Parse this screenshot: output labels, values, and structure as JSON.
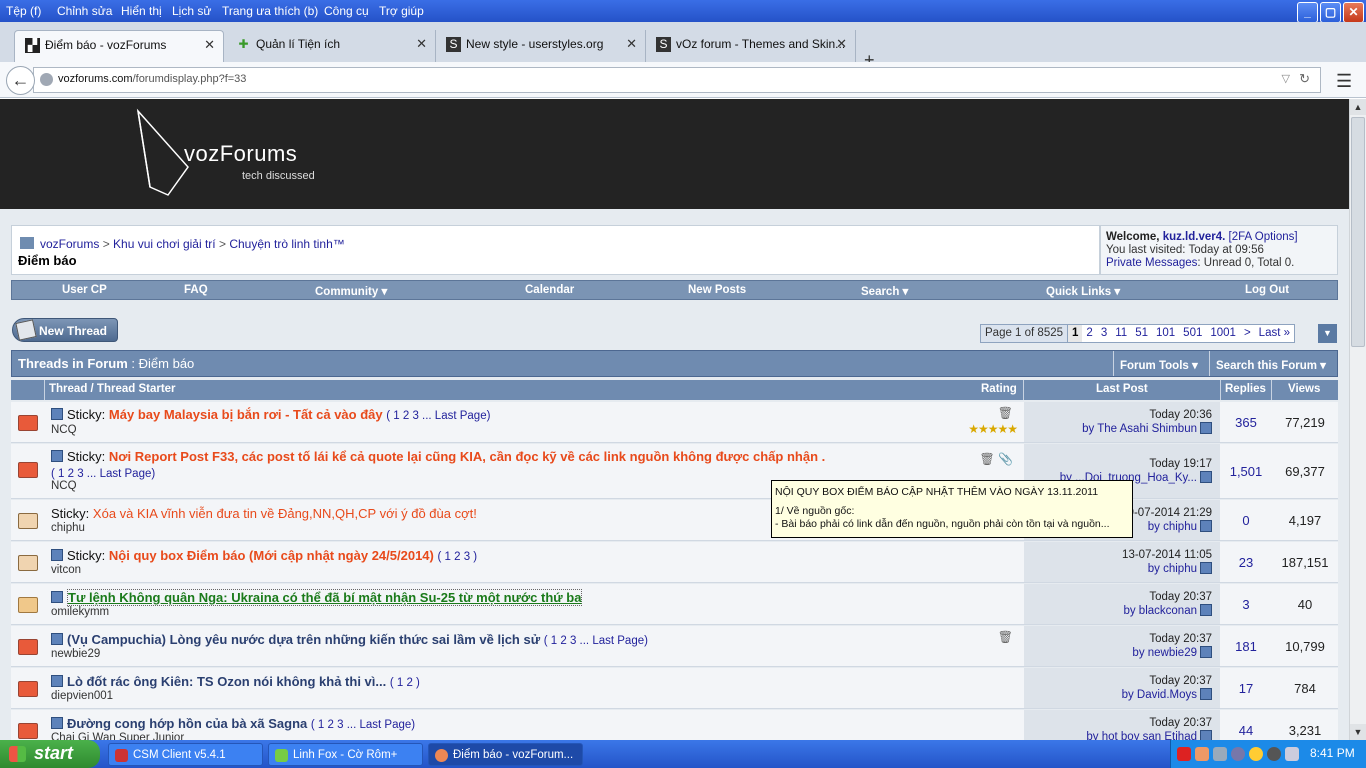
{
  "menu": [
    "Tệp (f)",
    "Chỉnh sửa",
    "Hiển thị",
    "Lịch sử",
    "Trang ưa thích (b)",
    "Công cụ",
    "Trợ giúp"
  ],
  "window_buttons": {
    "minimize": "_",
    "maximize": "▢",
    "close": "✕"
  },
  "tabs": [
    {
      "label": "Điểm báo - vozForums",
      "icon": "voz-icon",
      "active": true
    },
    {
      "label": "Quản lí Tiện ích",
      "icon": "puzzle-icon",
      "active": false
    },
    {
      "label": "New style - userstyles.org",
      "icon": "s-icon",
      "active": false
    },
    {
      "label": "vOz forum - Themes and Skin...",
      "icon": "s-icon",
      "active": false
    }
  ],
  "tab_close": "✕",
  "new_tab": "+",
  "url": {
    "host": "vozforums.com",
    "path": "/forumdisplay.php?f=33"
  },
  "logo": {
    "text": "vozForums",
    "tagline": "tech discussed"
  },
  "breadcrumbs": [
    "vozForums",
    "Khu vui chơi giải trí",
    "Chuyện trò linh tinh™"
  ],
  "crumb_sep": ">",
  "forum_title": "Điểm báo",
  "welcome": {
    "welcome_label": "Welcome,",
    "user": "kuz.ld.ver4.",
    "twofa": "[2FA Options]",
    "last_visited": "You last visited: Today at 09:56",
    "pm_label": "Private Messages",
    "pm_status": ": Unread 0, Total 0."
  },
  "navstrip": [
    "User CP",
    "FAQ",
    "Community ▾",
    "Calendar",
    "New Posts",
    "Search ▾",
    "Quick Links ▾",
    "Log Out"
  ],
  "new_thread": "New Thread",
  "pager": {
    "label": "Page 1 of 8525",
    "pages": [
      "1",
      "2",
      "3",
      "11",
      "51",
      "101",
      "501",
      "1001",
      ">",
      "Last »"
    ],
    "dropdown": "▼"
  },
  "threads_header": {
    "title": "Threads in Forum",
    "forum": ": Điểm báo",
    "tools": "Forum Tools ▾",
    "search": "Search this Forum ▾"
  },
  "columns": {
    "thread": "Thread / Thread Starter",
    "rating": "Rating",
    "last_post": "Last Post",
    "replies": "Replies",
    "views": "Views"
  },
  "threads": [
    {
      "prefix": "Sticky:",
      "title": "Máy bay Malaysia bị bắn rơi - Tất cả vào đây",
      "pages": "( 1 2 3 ... Last Page)",
      "starter": "NCQ",
      "rating": "★★★★★",
      "icons": "🗑",
      "date": "Today 20:36",
      "by": "by The Asahi Shimbun",
      "replies": "365",
      "views": "77,219"
    },
    {
      "prefix": "Sticky:",
      "title": "Nơi Report Post F33, các post tố lái kể cả quote lại cũng KIA, cần đọc kỹ về các link nguồn không được chấp nhận .",
      "pages": "( 1 2 3 ... Last Page)",
      "starter": "NCQ",
      "rating": "★★★★",
      "icons": "🗑 📎",
      "date": "Today 19:17",
      "by": "by ...Doi_truong_Hoa_Ky...",
      "replies": "1,501",
      "views": "69,377"
    },
    {
      "prefix": "Sticky:",
      "title": "Xóa và KIA vĩnh viễn đưa tin về Đảng,NN,QH,CP với ý đồ đùa cợt!",
      "pages": "",
      "starter": "chiphu",
      "rating": "",
      "icons": "",
      "date": "19-07-2014 21:29",
      "by": "by chiphu",
      "replies": "0",
      "views": "4,197"
    },
    {
      "prefix": "Sticky:",
      "title": "Nội quy box Điểm báo (Mới cập nhật ngày 24/5/2014)",
      "pages": "( 1 2 3 )",
      "starter": "vitcon",
      "rating": "",
      "icons": "",
      "date": "13-07-2014 11:05",
      "by": "by chiphu",
      "replies": "23",
      "views": "187,151"
    },
    {
      "prefix": "",
      "title": "Tư lệnh Không quân Nga: Ukraina có thể đã bí mật nhận Su-25 từ một nước thứ ba",
      "pages": "",
      "starter": "omilekymm",
      "rating": "",
      "icons": "",
      "date": "Today 20:37",
      "by": "by blackconan",
      "replies": "3",
      "views": "40"
    },
    {
      "prefix": "",
      "title": "(Vụ Campuchia) Lòng yêu nước dựa trên những kiến thức sai lầm về lịch sử",
      "pages": "( 1 2 3 ... Last Page)",
      "starter": "newbie29",
      "rating": "",
      "icons": "🗑",
      "date": "Today 20:37",
      "by": "by newbie29",
      "replies": "181",
      "views": "10,799"
    },
    {
      "prefix": "",
      "title": "Lò đốt rác ông Kiên: TS Ozon nói không khả thi vì...",
      "pages": "( 1 2 )",
      "starter": "diepvien001",
      "rating": "",
      "icons": "",
      "date": "Today 20:37",
      "by": "by David.Moys",
      "replies": "17",
      "views": "784"
    },
    {
      "prefix": "",
      "title": "Đường cong hớp hồn của bà xã Sagna",
      "pages": "( 1 2 3 ... Last Page)",
      "starter": "Chai Gi Wan Super Junior",
      "rating": "",
      "icons": "",
      "date": "Today 20:37",
      "by": "by hot boy san Etihad",
      "replies": "44",
      "views": "3,231"
    }
  ],
  "tooltip": {
    "line1": "NỘI QUY BOX ĐIỂM BÁO CẬP NHẬT THÊM VÀO NGÀY 13.11.2011",
    "line2": "1/ Về nguồn gốc:",
    "line3": "-    Bài báo phải có link dẫn đến nguồn, nguồn phải còn tồn tại và nguồn..."
  },
  "taskbar": {
    "start": "start",
    "tasks": [
      "CSM Client v5.4.1",
      "Linh Fox - Cờ Rôm+",
      "Điểm báo - vozForum..."
    ],
    "clock": "8:41 PM"
  },
  "colors": {
    "sticky_title": "#e84a1b",
    "green_title": "#1a7a1a",
    "nav_blue": "#6f8bb0",
    "banner": "#232323"
  }
}
